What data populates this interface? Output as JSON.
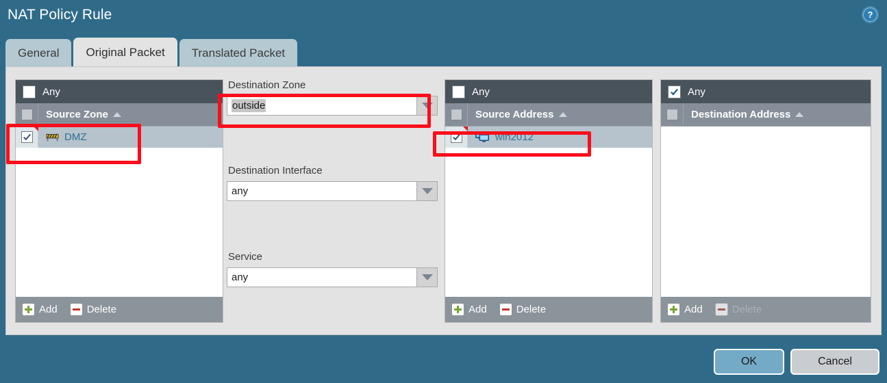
{
  "dialog": {
    "title": "NAT Policy Rule",
    "help_icon": "help-circle-icon",
    "help_glyph": "?"
  },
  "tabs": [
    {
      "label": "General",
      "active": false
    },
    {
      "label": "Original Packet",
      "active": true
    },
    {
      "label": "Translated Packet",
      "active": false
    }
  ],
  "columns": {
    "source_zone": {
      "any_label": "Any",
      "any_checked": false,
      "header": "Source Zone",
      "sort": "ascending",
      "header_checkbox_state": "dim",
      "rows": [
        {
          "label": "DMZ",
          "checked": true,
          "icon": "zone-barrier-icon",
          "flagged": true
        }
      ],
      "add_label": "Add",
      "delete_label": "Delete",
      "delete_enabled": true
    },
    "middle": {
      "destination_zone": {
        "label": "Destination Zone",
        "value": "outside",
        "selected": true,
        "placeholder": ""
      },
      "destination_interface": {
        "label": "Destination Interface",
        "value": "any",
        "placeholder": ""
      },
      "service": {
        "label": "Service",
        "value": "any",
        "placeholder": ""
      }
    },
    "source_address": {
      "any_label": "Any",
      "any_checked": false,
      "header": "Source Address",
      "sort": "ascending",
      "header_checkbox_state": "dim",
      "rows": [
        {
          "label": "win2012",
          "checked": true,
          "icon": "computer-monitors-icon",
          "flagged": true
        }
      ],
      "add_label": "Add",
      "delete_label": "Delete",
      "delete_enabled": true
    },
    "destination_address": {
      "any_label": "Any",
      "any_checked": true,
      "header": "Destination Address",
      "sort": "ascending",
      "header_checkbox_state": "dim",
      "rows": [],
      "add_label": "Add",
      "delete_label": "Delete",
      "delete_enabled": false
    }
  },
  "footer": {
    "ok_label": "OK",
    "cancel_label": "Cancel"
  },
  "colors": {
    "dialog_background": "#2f6b89",
    "panel_background": "#e3e3e3",
    "any_row": "#49535c",
    "header_row": "#868f99",
    "selected_row": "#b6c3cc",
    "link_text": "#2e6f96",
    "annotation": "#fc0d1b",
    "ok_button": "#73aac6",
    "cancel_button": "#c9ccd0",
    "add_icon": "#7aa430",
    "delete_icon": "#c0392b"
  }
}
